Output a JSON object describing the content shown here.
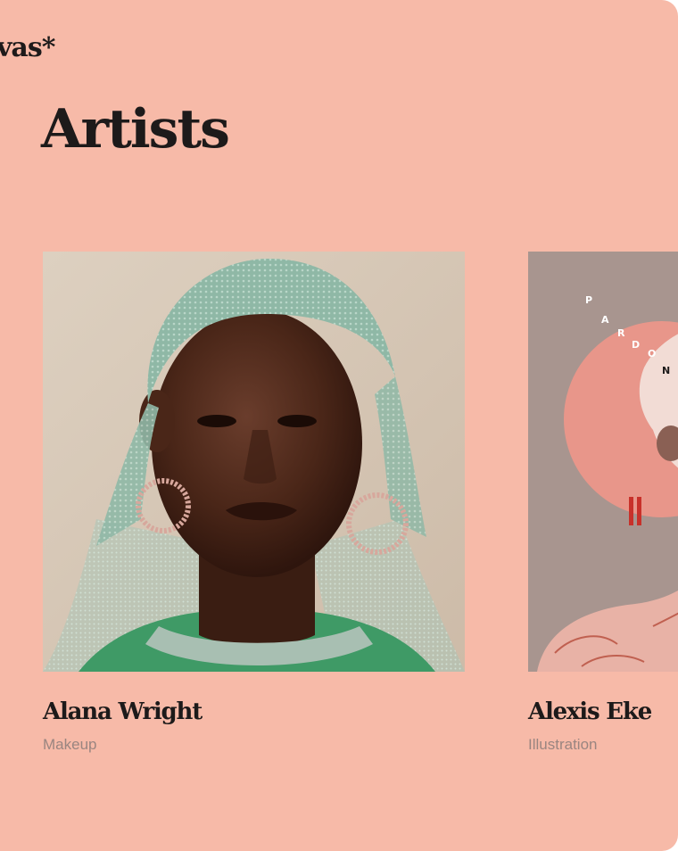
{
  "app": {
    "brand": "vas*",
    "page_title": "Artists"
  },
  "artists": [
    {
      "name": "Alana Wright",
      "role": "Makeup",
      "photo": "portrait-photo-green-headscarf-hoop-earrings"
    },
    {
      "name": "Alexis Eke",
      "role": "Illustration",
      "photo": "illustration-pink-circle-figure",
      "illustration_text": [
        "P",
        "A",
        "R",
        "D",
        "O",
        "N"
      ]
    }
  ],
  "colors": {
    "background": "#f7baa8",
    "text_primary": "#1d1a1a",
    "text_secondary": "#9a8580"
  }
}
